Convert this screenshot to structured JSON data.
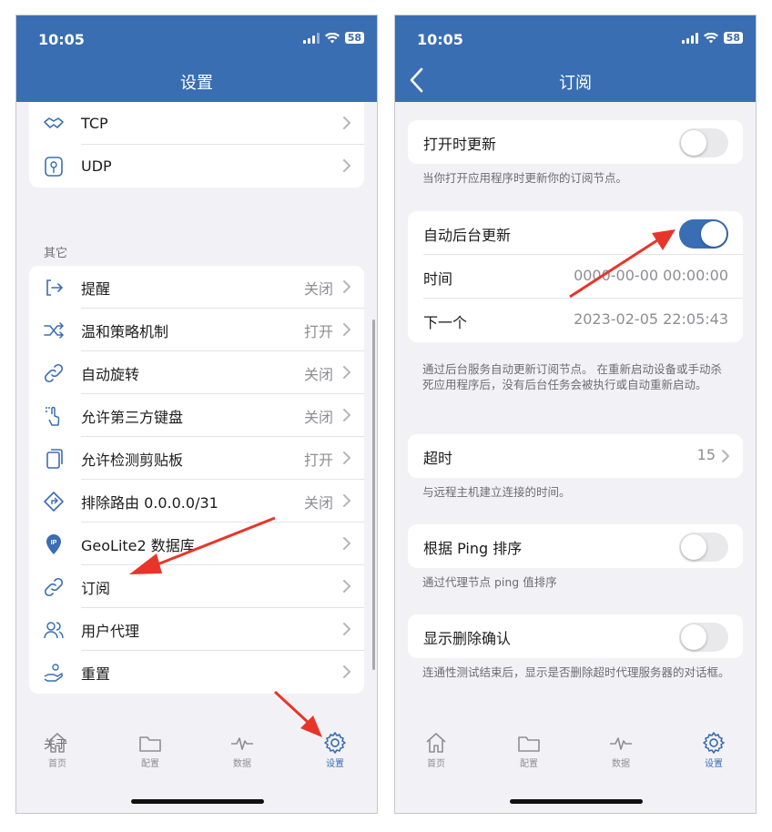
{
  "left": {
    "status_time": "10:05",
    "battery": "58",
    "nav_title": "设置",
    "top_items": [
      {
        "label": "TCP",
        "value": "",
        "icon": "handshake-icon"
      },
      {
        "label": "UDP",
        "value": "",
        "icon": "udp-icon"
      }
    ],
    "section_other": "其它",
    "other_items": [
      {
        "label": "提醒",
        "value": "关闭",
        "icon": "login-arrow-icon"
      },
      {
        "label": "温和策略机制",
        "value": "打开",
        "icon": "shuffle-icon"
      },
      {
        "label": "自动旋转",
        "value": "关闭",
        "icon": "link-icon"
      },
      {
        "label": "允许第三方键盘",
        "value": "关闭",
        "icon": "hand-tap-icon"
      },
      {
        "label": "允许检测剪贴板",
        "value": "打开",
        "icon": "clipboard-icon"
      },
      {
        "label": "排除路由 0.0.0.0/31",
        "value": "关闭",
        "icon": "route-icon"
      },
      {
        "label": "GeoLite2 数据库",
        "value": "",
        "icon": "geo-pin-icon"
      },
      {
        "label": "订阅",
        "value": "",
        "icon": "link-icon"
      },
      {
        "label": "用户代理",
        "value": "",
        "icon": "users-icon"
      },
      {
        "label": "重置",
        "value": "",
        "icon": "reset-hand-icon"
      }
    ],
    "section_about": "关于",
    "tabs": [
      {
        "label": "首页",
        "icon": "home-icon",
        "active": false
      },
      {
        "label": "配置",
        "icon": "folder-icon",
        "active": false
      },
      {
        "label": "数据",
        "icon": "pulse-icon",
        "active": false
      },
      {
        "label": "设置",
        "icon": "gear-icon",
        "active": true
      }
    ]
  },
  "right": {
    "status_time": "10:05",
    "battery": "58",
    "nav_title": "订阅",
    "open_update": {
      "label": "打开时更新",
      "on": false,
      "footer": "当你打开应用程序时更新你的订阅节点。"
    },
    "auto_update": {
      "label": "自动后台更新",
      "on": true
    },
    "time": {
      "label": "时间",
      "value": "0000-00-00 00:00:00"
    },
    "next": {
      "label": "下一个",
      "value": "2023-02-05 22:05:43"
    },
    "auto_footer": "通过后台服务自动更新订阅节点。 在重新启动设备或手动杀死应用程序后，没有后台任务会被执行或自动重新启动。",
    "timeout": {
      "label": "超时",
      "value": "15",
      "footer": "与远程主机建立连接的时间。"
    },
    "ping_sort": {
      "label": "根据 Ping 排序",
      "on": false,
      "footer": "通过代理节点 ping 值排序"
    },
    "delete_confirm": {
      "label": "显示删除确认",
      "on": false,
      "footer": "连通性测试结束后，显示是否删除超时代理服务器的对话框。"
    },
    "tabs": [
      {
        "label": "首页",
        "icon": "home-icon",
        "active": false
      },
      {
        "label": "配置",
        "icon": "folder-icon",
        "active": false
      },
      {
        "label": "数据",
        "icon": "pulse-icon",
        "active": false
      },
      {
        "label": "设置",
        "icon": "gear-icon",
        "active": true
      }
    ]
  },
  "colors": {
    "brand": "#3a6eb3",
    "annotation_arrow": "#e8352a"
  }
}
